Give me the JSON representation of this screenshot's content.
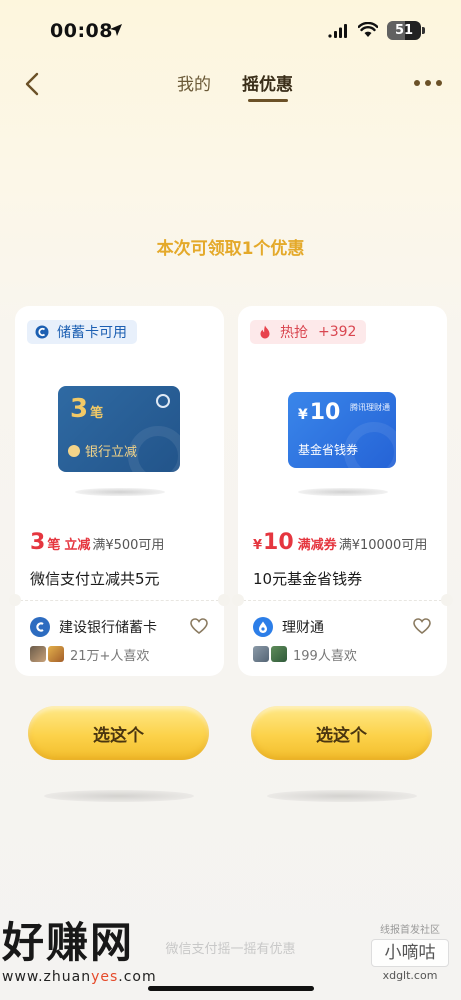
{
  "status_bar": {
    "time": "00:08",
    "battery": "51"
  },
  "nav": {
    "tabs": [
      {
        "label": "我的"
      },
      {
        "label": "摇优惠"
      }
    ],
    "active_tab": "摇优惠"
  },
  "headline": "本次可领取1个优惠",
  "cards": [
    {
      "badge": "储蓄卡可用",
      "coupon": {
        "count": "3",
        "count_unit": "笔",
        "subtitle": "银行立减"
      },
      "price": {
        "value": "3",
        "unit": "笔",
        "tag": "立减",
        "condition": "满¥500可用"
      },
      "title": "微信支付立减共5元",
      "brand": "建设银行储蓄卡",
      "likes": "21万+人喜欢"
    },
    {
      "badge": "热抢",
      "badge_extra": "+392",
      "coupon": {
        "amount": "10",
        "currency": "¥",
        "name": "基金省钱券",
        "brand": "腾讯理财通"
      },
      "price": {
        "currency": "¥",
        "value": "10",
        "tag": "满减券",
        "condition": "满¥10000可用"
      },
      "title": "10元基金省钱券",
      "brand": "理财通",
      "likes": "199人喜欢"
    }
  ],
  "buttons": {
    "choose_label": "选这个"
  },
  "footer": {
    "note": "微信支付摇一摇有优惠"
  },
  "watermark": {
    "left_big": "好赚网",
    "left_url_pre": "www.zhuan",
    "left_url_mid": "yes",
    "left_url_post": ".com",
    "right_sub": "线报首发社区",
    "right_name": "小嘀咕",
    "right_url": "xdglt.com"
  },
  "colors": {
    "accent_gold": "#e4a92a",
    "price_red": "#e5363f",
    "badge_blue": "#1c5fb2",
    "button_yellow": "#fcd24a"
  }
}
